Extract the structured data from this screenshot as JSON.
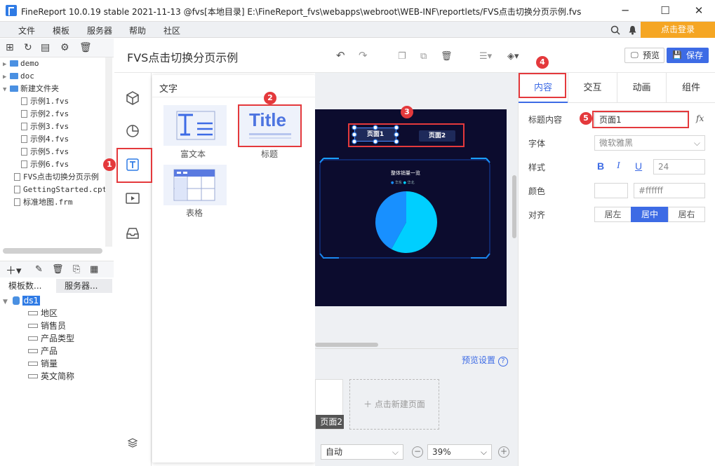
{
  "titlebar": {
    "title": "FineReport 10.0.19 stable 2021-11-13 @fvs[本地目录]     E:\\FineReport_fvs\\webapps\\webroot\\WEB-INF\\reportlets/FVS点击切换分页示例.fvs",
    "minimize": "─",
    "maximize": "☐",
    "close": "✕"
  },
  "menu": {
    "items": [
      "文件",
      "模板",
      "服务器",
      "帮助",
      "社区"
    ],
    "login": "点击登录"
  },
  "filetree": {
    "items": [
      {
        "label": "demo",
        "type": "folder",
        "depth": 0
      },
      {
        "label": "doc",
        "type": "folder",
        "depth": 0
      },
      {
        "label": "新建文件夹",
        "type": "folder",
        "depth": 0,
        "open": true
      },
      {
        "label": "示例1.fvs",
        "type": "file",
        "depth": 2
      },
      {
        "label": "示例2.fvs",
        "type": "file",
        "depth": 2
      },
      {
        "label": "示例3.fvs",
        "type": "file",
        "depth": 2
      },
      {
        "label": "示例4.fvs",
        "type": "file",
        "depth": 2
      },
      {
        "label": "示例5.fvs",
        "type": "file",
        "depth": 2
      },
      {
        "label": "示例6.fvs",
        "type": "file",
        "depth": 2
      },
      {
        "label": "FVS点击切换分页示例",
        "type": "file",
        "depth": 1
      },
      {
        "label": "GettingStarted.cpt",
        "type": "file",
        "depth": 1
      },
      {
        "label": "标准地图.frm",
        "type": "file",
        "depth": 1
      }
    ]
  },
  "datapanel": {
    "tabs": [
      "模板数...",
      "服务器..."
    ],
    "dataset": "ds1",
    "fields": [
      "地区",
      "销售员",
      "产品类型",
      "产品",
      "销量",
      "英文简称"
    ]
  },
  "editor": {
    "doc_title": "FVS点击切换分页示例",
    "preview": "预览",
    "save": "保存"
  },
  "component_panel": {
    "header": "文字",
    "items": [
      {
        "label": "富文本"
      },
      {
        "label": "标题",
        "thumb_text": "Title"
      },
      {
        "label": "表格"
      }
    ]
  },
  "canvas": {
    "page_tabs": [
      "页面1",
      "页面2"
    ],
    "chart_title": "整体销量一览",
    "legend": [
      "华东",
      "华北"
    ],
    "pie": {
      "slices": [
        0.42,
        0.58
      ],
      "colors": [
        "#1890ff",
        "#00cfff"
      ]
    }
  },
  "bottom": {
    "preview_settings": "预览设置",
    "new_page": "＋ 点击新建页面",
    "page_thumb": "页面2",
    "auto": "自动",
    "zoom": "39%"
  },
  "right": {
    "tabs": [
      "内容",
      "交互",
      "动画",
      "组件"
    ],
    "active_tab": "内容",
    "fields": {
      "title_content_label": "标题内容",
      "title_content": "页面1",
      "fx": "fx",
      "font_label": "字体",
      "font": "微软雅黑",
      "style_label": "样式",
      "bold": "B",
      "italic": "I",
      "underline": "U",
      "size": "24",
      "color_label": "颜色",
      "color_value": "#ffffff",
      "align_label": "对齐",
      "align": [
        "居左",
        "居中",
        "居右"
      ],
      "align_active": "居中"
    }
  },
  "badges": [
    "1",
    "2",
    "3",
    "4",
    "5"
  ],
  "colors": {
    "accent": "#3d6be5",
    "brand": "#2f7be5",
    "login": "#f5a623",
    "highlight": "#e4393c"
  }
}
